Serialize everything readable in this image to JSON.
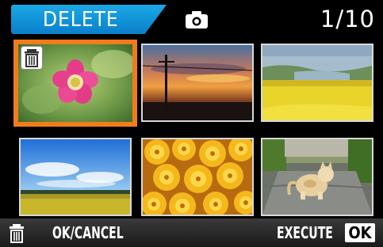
{
  "header": {
    "mode_label": "DELETE",
    "mode_icon": "camera-icon",
    "frame_counter": "1/10"
  },
  "grid": {
    "items": [
      {
        "subject": "pink flower",
        "selected": true,
        "marked_for_delete": true
      },
      {
        "subject": "sunset with utility pole",
        "selected": false,
        "marked_for_delete": false
      },
      {
        "subject": "yellow canola field",
        "selected": false,
        "marked_for_delete": false
      },
      {
        "subject": "blue sky over field",
        "selected": false,
        "marked_for_delete": false
      },
      {
        "subject": "orange and yellow flowers",
        "selected": false,
        "marked_for_delete": false
      },
      {
        "subject": "cat on path",
        "selected": false,
        "marked_for_delete": false
      }
    ]
  },
  "footer": {
    "icon": "trash-icon",
    "ok_cancel_label": "OK/CANCEL",
    "execute_label": "EXECUTE",
    "ok_key_label": "OK"
  },
  "colors": {
    "mode_tab": "#0a7fc9",
    "selection": "#f07c1c",
    "background": "#000000"
  }
}
